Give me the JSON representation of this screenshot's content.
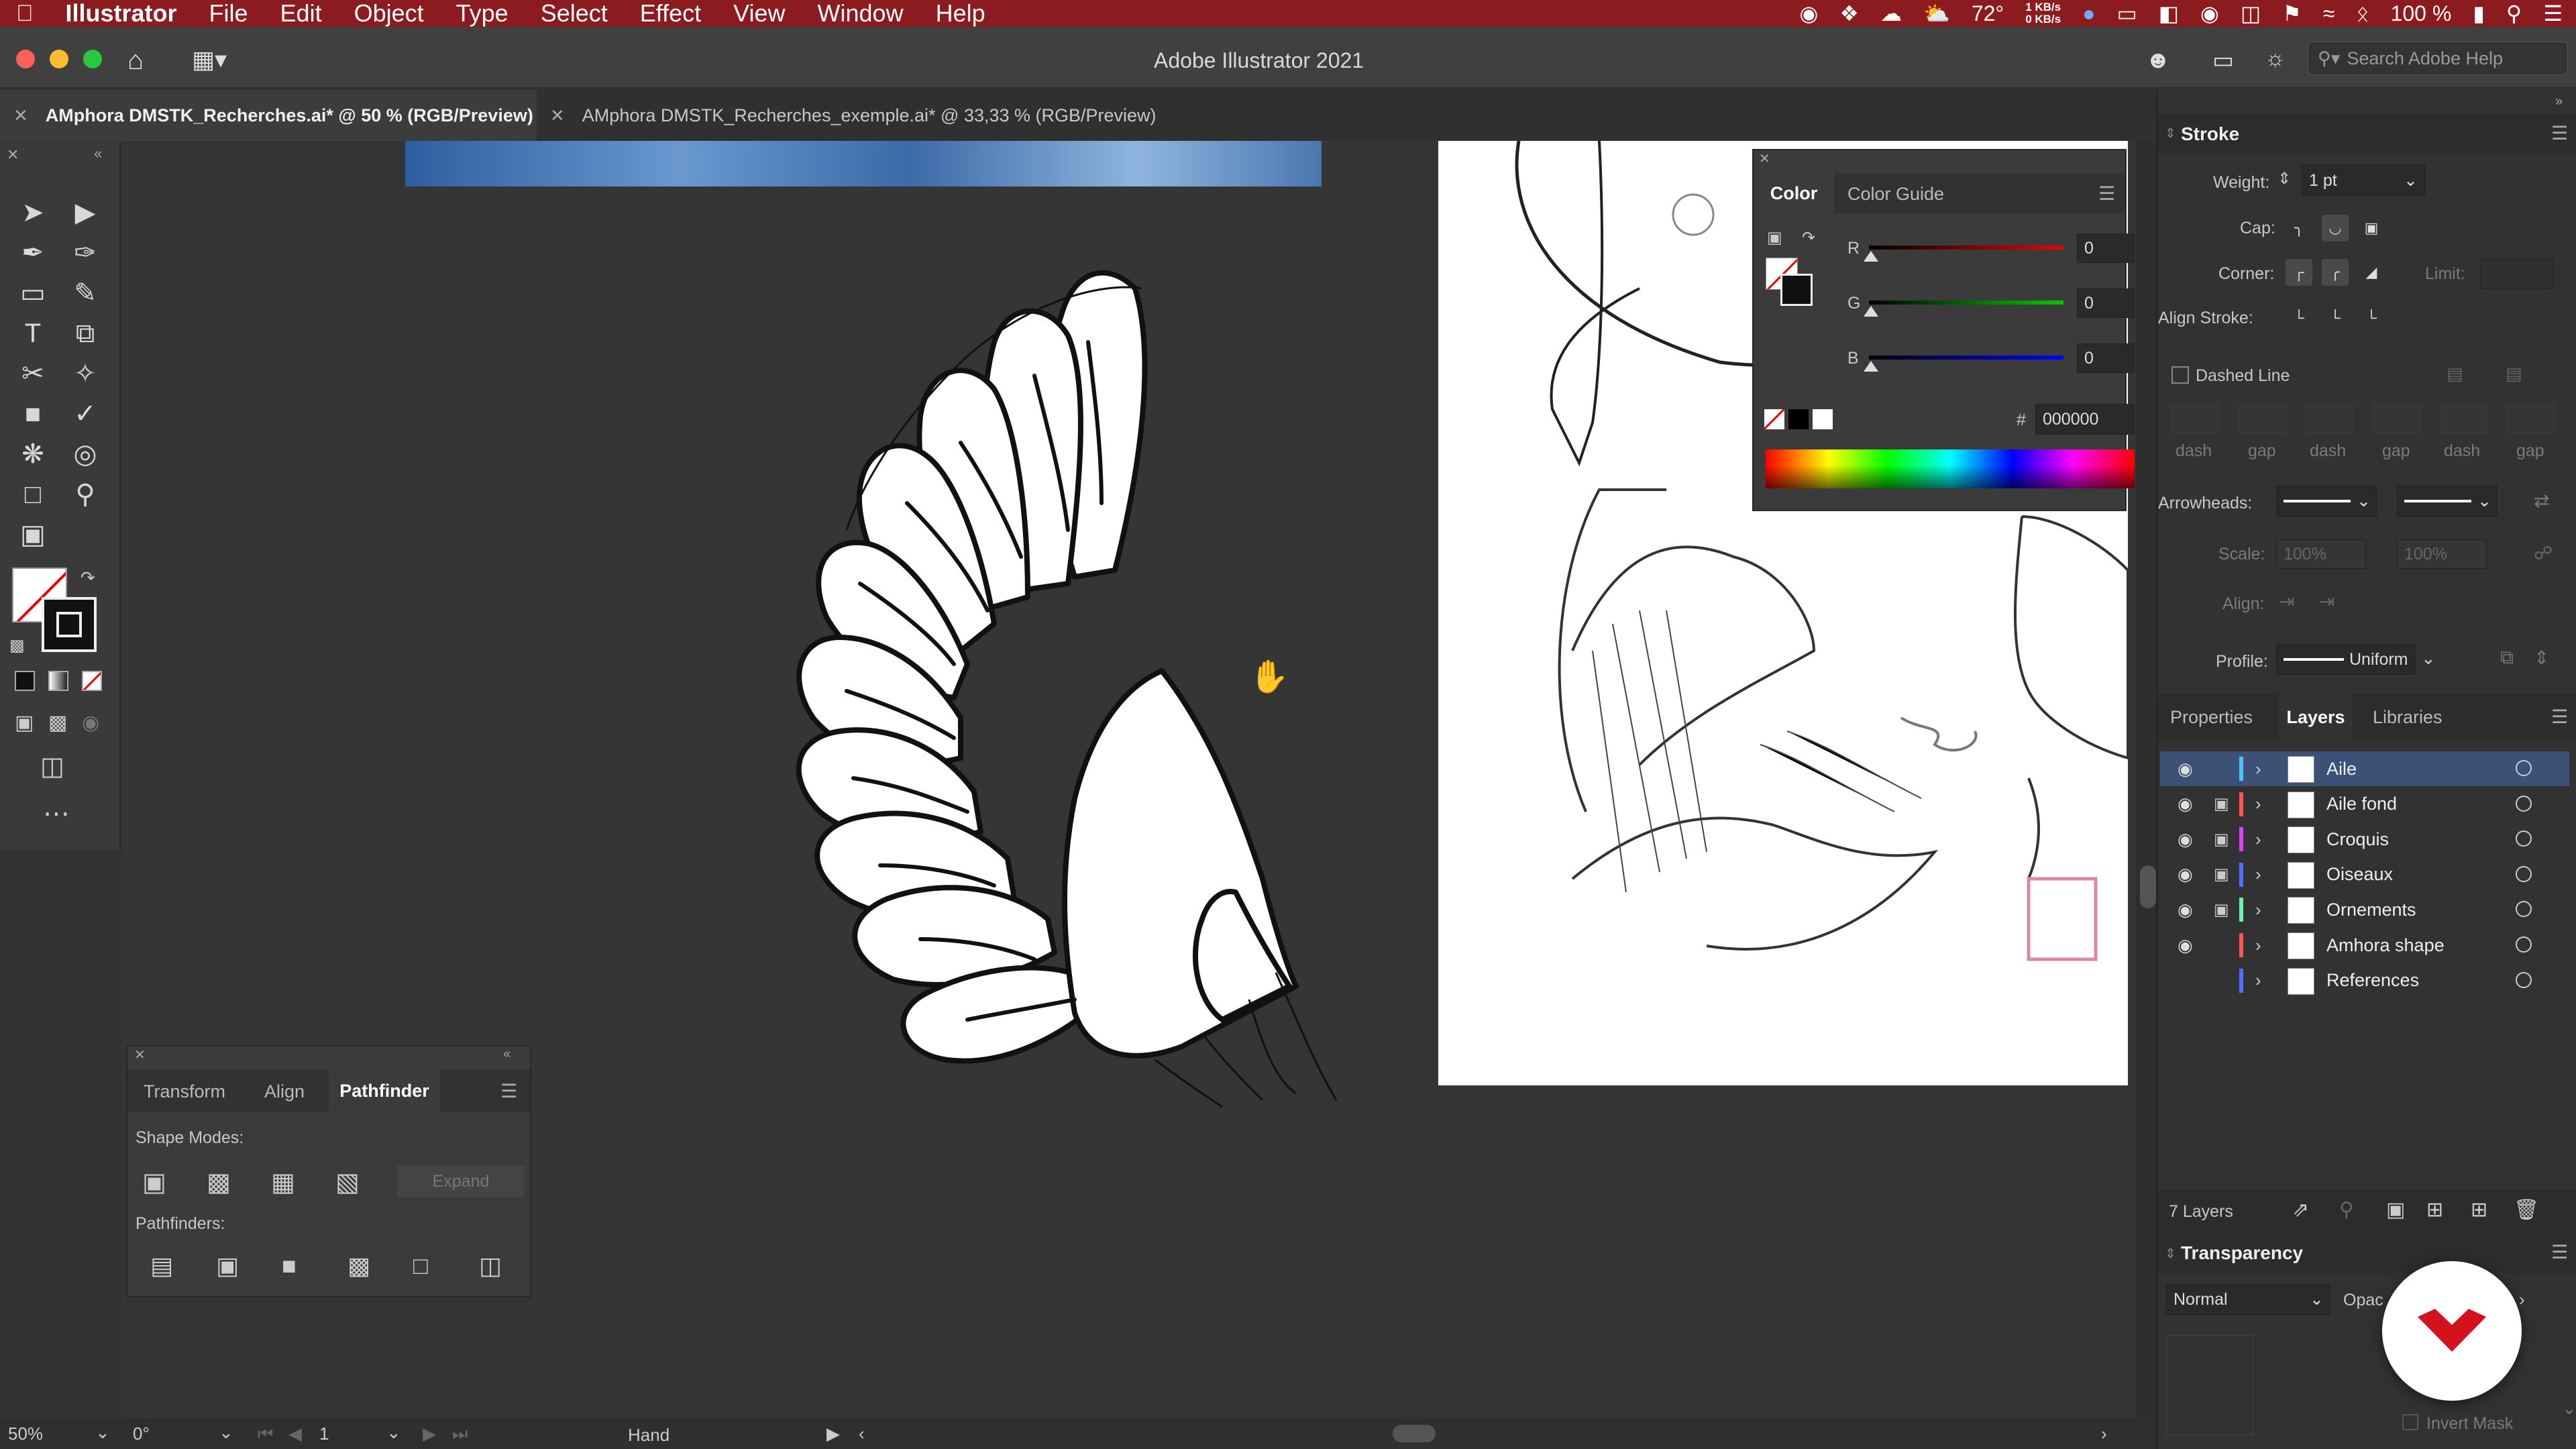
{
  "menubar": {
    "apple_icon": "apple-icon",
    "app_name": "Illustrator",
    "items": [
      "File",
      "Edit",
      "Object",
      "Type",
      "Select",
      "Effect",
      "View",
      "Window",
      "Help"
    ],
    "temp": "72°",
    "net_up": "1 KB/s",
    "net_down": "0 KB/s",
    "battery": "100 %"
  },
  "window": {
    "title": "Adobe Illustrator 2021",
    "search_placeholder": "Search Adobe Help"
  },
  "tabs": [
    {
      "label": "AMphora DMSTK_Recherches.ai* @ 50 % (RGB/Preview)",
      "active": true
    },
    {
      "label": "AMphora DMSTK_Recherches_exemple.ai* @ 33,33 % (RGB/Preview)",
      "active": false
    }
  ],
  "stroke_panel": {
    "title": "Stroke",
    "weight_label": "Weight:",
    "weight_value": "1 pt",
    "cap_label": "Cap:",
    "corner_label": "Corner:",
    "limit_label": "Limit:",
    "align_label": "Align Stroke:",
    "dashed_label": "Dashed Line",
    "dash_labels": [
      "dash",
      "gap",
      "dash",
      "gap",
      "dash",
      "gap"
    ],
    "arrowheads_label": "Arrowheads:",
    "scale_label": "Scale:",
    "scale_values": [
      "100%",
      "100%"
    ],
    "align2_label": "Align:",
    "profile_label": "Profile:",
    "profile_value": "Uniform"
  },
  "color_panel": {
    "tabs": [
      "Color",
      "Color Guide"
    ],
    "r_label": "R",
    "r_value": "0",
    "g_label": "G",
    "g_value": "0",
    "b_label": "B",
    "b_value": "0",
    "hex_label": "#",
    "hex_value": "000000"
  },
  "layers_panel": {
    "tabs": [
      "Properties",
      "Layers",
      "Libraries"
    ],
    "layers": [
      {
        "name": "Aile",
        "color": "#4fc3f7",
        "locked": false,
        "visible": true,
        "selected": true
      },
      {
        "name": "Aile fond",
        "color": "#ff5252",
        "locked": true,
        "visible": true,
        "selected": false
      },
      {
        "name": "Croquis",
        "color": "#e040fb",
        "locked": true,
        "visible": true,
        "selected": false
      },
      {
        "name": "Oiseaux",
        "color": "#536dfe",
        "locked": true,
        "visible": true,
        "selected": false
      },
      {
        "name": "Ornements",
        "color": "#69f0ae",
        "locked": true,
        "visible": true,
        "selected": false
      },
      {
        "name": "Amhora shape",
        "color": "#ff5252",
        "locked": false,
        "visible": true,
        "selected": false
      },
      {
        "name": "References",
        "color": "#536dfe",
        "locked": false,
        "visible": false,
        "selected": false
      }
    ],
    "count": "7 Layers"
  },
  "transparency_panel": {
    "title": "Transparency",
    "mode": "Normal",
    "opacity_label": "Opac",
    "invert_mask": "Invert Mask"
  },
  "pathfinder_panel": {
    "tabs": [
      "Transform",
      "Align",
      "Pathfinder"
    ],
    "shape_modes_label": "Shape Modes:",
    "expand_label": "Expand",
    "pathfinders_label": "Pathfinders:"
  },
  "statusbar": {
    "zoom": "50%",
    "rotation": "0°",
    "artboard": "1",
    "tool": "Hand"
  },
  "colors": {
    "menubar_bg": "#8c1b1f",
    "selected_layer": "#3c5175",
    "brand_red": "#d3121e"
  }
}
